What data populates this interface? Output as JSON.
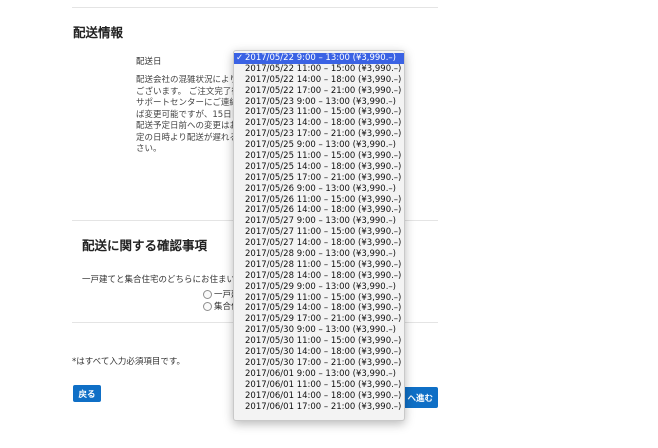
{
  "delivery_info": {
    "heading": "配送情報",
    "date_label": "配送日",
    "description_lines": [
      "配送会社の混雑状況により、",
      "ございます。 ご注文完了後の",
      "サポートセンターにご連絡く",
      "ば変更可能ですが、15日目お",
      "配送予定日前への変更はお受",
      "定の日時より配送が遅れる場",
      "さい。"
    ]
  },
  "confirmation": {
    "heading": "配送に関する確認事項",
    "question": "一戸建てと集合住宅のどちらにお住まいです",
    "options": [
      "一戸建",
      "集合住"
    ]
  },
  "footer": {
    "required_note": "*はすべて入力必須項目です。",
    "back_button": "戻る",
    "next_button": "ヘ進む"
  },
  "dropdown": {
    "check_glyph": "✓",
    "selected_index": 0,
    "options": [
      "2017/05/22 9:00 – 13:00 (¥3,990.–)",
      "2017/05/22 11:00 – 15:00 (¥3,990.–)",
      "2017/05/22 14:00 – 18:00 (¥3,990.–)",
      "2017/05/22 17:00 – 21:00 (¥3,990.–)",
      "2017/05/23 9:00 – 13:00 (¥3,990.–)",
      "2017/05/23 11:00 – 15:00 (¥3,990.–)",
      "2017/05/23 14:00 – 18:00 (¥3,990.–)",
      "2017/05/23 17:00 – 21:00 (¥3,990.–)",
      "2017/05/25 9:00 – 13:00 (¥3,990.–)",
      "2017/05/25 11:00 – 15:00 (¥3,990.–)",
      "2017/05/25 14:00 – 18:00 (¥3,990.–)",
      "2017/05/25 17:00 – 21:00 (¥3,990.–)",
      "2017/05/26 9:00 – 13:00 (¥3,990.–)",
      "2017/05/26 11:00 – 15:00 (¥3,990.–)",
      "2017/05/26 14:00 – 18:00 (¥3,990.–)",
      "2017/05/27 9:00 – 13:00 (¥3,990.–)",
      "2017/05/27 11:00 – 15:00 (¥3,990.–)",
      "2017/05/27 14:00 – 18:00 (¥3,990.–)",
      "2017/05/28 9:00 – 13:00 (¥3,990.–)",
      "2017/05/28 11:00 – 15:00 (¥3,990.–)",
      "2017/05/28 14:00 – 18:00 (¥3,990.–)",
      "2017/05/29 9:00 – 13:00 (¥3,990.–)",
      "2017/05/29 11:00 – 15:00 (¥3,990.–)",
      "2017/05/29 14:00 – 18:00 (¥3,990.–)",
      "2017/05/29 17:00 – 21:00 (¥3,990.–)",
      "2017/05/30 9:00 – 13:00 (¥3,990.–)",
      "2017/05/30 11:00 – 15:00 (¥3,990.–)",
      "2017/05/30 14:00 – 18:00 (¥3,990.–)",
      "2017/05/30 17:00 – 21:00 (¥3,990.–)",
      "2017/06/01 9:00 – 13:00 (¥3,990.–)",
      "2017/06/01 11:00 – 15:00 (¥3,990.–)",
      "2017/06/01 14:00 – 18:00 (¥3,990.–)",
      "2017/06/01 17:00 – 21:00 (¥3,990.–)"
    ]
  }
}
